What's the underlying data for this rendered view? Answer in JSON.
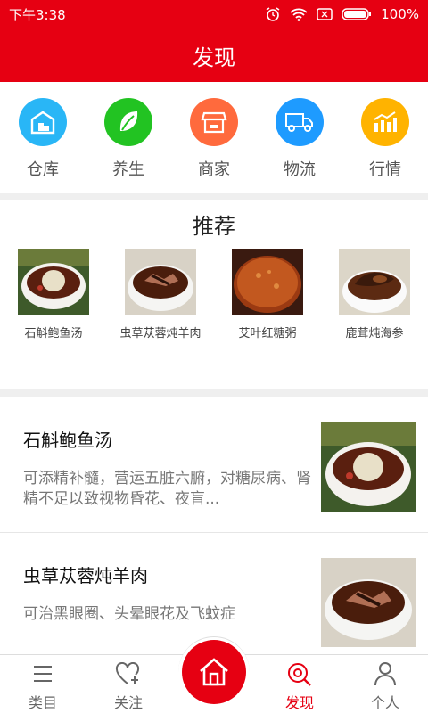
{
  "status": {
    "time": "下午3:38",
    "battery": "100%"
  },
  "header": {
    "title": "发现"
  },
  "categories": [
    {
      "label": "仓库",
      "icon": "warehouse-icon",
      "color": "#29b6f6"
    },
    {
      "label": "养生",
      "icon": "leaf-icon",
      "color": "#22c322"
    },
    {
      "label": "商家",
      "icon": "store-icon",
      "color": "#ff6a3d"
    },
    {
      "label": "物流",
      "icon": "truck-icon",
      "color": "#1e9bff"
    },
    {
      "label": "行情",
      "icon": "chart-icon",
      "color": "#ffb300"
    }
  ],
  "recommend": {
    "title": "推荐",
    "items": [
      {
        "name": "石斛鲍鱼汤"
      },
      {
        "name": "虫草苁蓉炖羊肉"
      },
      {
        "name": "艾叶红糖粥"
      },
      {
        "name": "鹿茸炖海参"
      }
    ]
  },
  "articles": [
    {
      "title": "石斛鲍鱼汤",
      "desc": "可添精补髓，营运五脏六腑，对糖尿病、肾精不足以致视物昏花、夜盲..."
    },
    {
      "title": "虫草苁蓉炖羊肉",
      "desc": "可治黑眼圈、头晕眼花及飞蚊症"
    }
  ],
  "tabs": [
    {
      "label": "类目",
      "icon": "list-icon"
    },
    {
      "label": "关注",
      "icon": "heart-plus-icon"
    },
    {
      "label": "发现",
      "icon": "discover-icon"
    },
    {
      "label": "个人",
      "icon": "person-icon"
    }
  ],
  "colors": {
    "brand": "#e60012"
  }
}
